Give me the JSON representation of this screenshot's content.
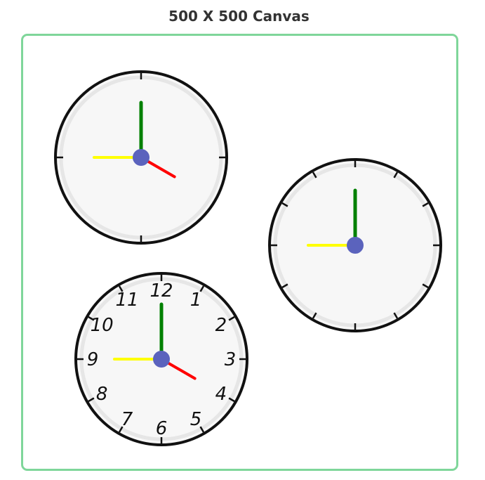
{
  "header": {
    "title": "500 X 500 Canvas"
  },
  "canvas": {
    "border_color": "#7fd69a"
  },
  "clocks": [
    {
      "name": "clock-plain",
      "tick_style": "quarter",
      "time": {
        "hour": 4,
        "minute": 0,
        "second": 45
      },
      "numerals": []
    },
    {
      "name": "clock-ticks",
      "tick_style": "all",
      "time": {
        "hour": null,
        "minute": 0,
        "second": 45
      },
      "numerals": []
    },
    {
      "name": "clock-numbers",
      "tick_style": "all",
      "time": {
        "hour": 4,
        "minute": 0,
        "second": 45
      },
      "numerals": [
        "12",
        "1",
        "2",
        "3",
        "4",
        "5",
        "6",
        "7",
        "8",
        "9",
        "10",
        "11"
      ]
    }
  ],
  "colors": {
    "hour_hand": "#ff0000",
    "minute_hand": "#008000",
    "second_hand": "#ffff00",
    "hub": "#5b63bd",
    "face": "#f7f7f7",
    "rim": "#111111"
  },
  "icons": {
    "clock": "clock-icon"
  }
}
